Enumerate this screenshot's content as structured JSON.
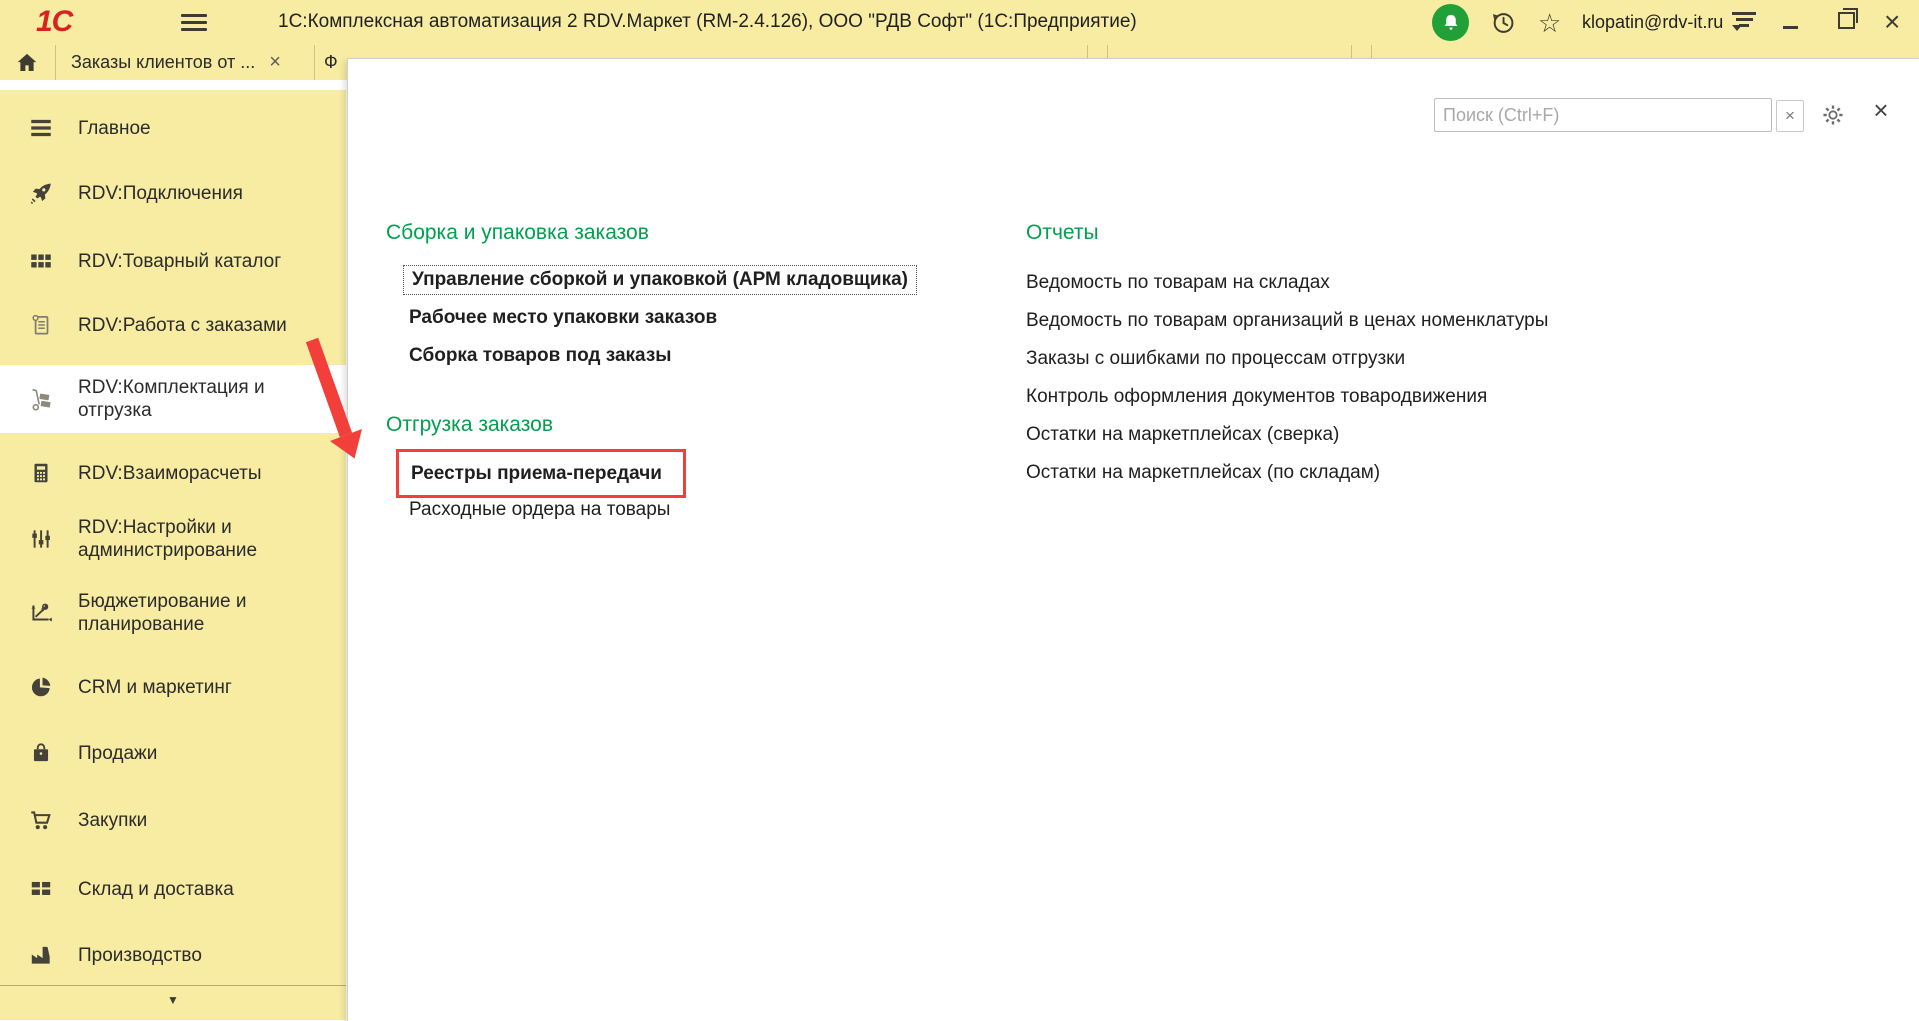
{
  "titlebar": {
    "logo": "1С",
    "app_title": "1С:Комплексная автоматизация 2 RDV.Маркет (RM-2.4.126), ООО \"РДВ Софт\"  (1С:Предприятие)",
    "user_email": "klopatin@rdv-it.ru"
  },
  "tabs": {
    "tab1_label": "Заказы клиентов от ...",
    "tab2_partial": "Ф"
  },
  "sidebar": {
    "items": [
      {
        "label": "Главное"
      },
      {
        "label": "RDV:Подключения"
      },
      {
        "label": "RDV:Товарный каталог"
      },
      {
        "label": "RDV:Работа с заказами"
      },
      {
        "label": "RDV:Комплектация и отгрузка",
        "selected": true
      },
      {
        "label": "RDV:Взаиморасчеты"
      },
      {
        "label": "RDV:Настройки и администрирование"
      },
      {
        "label": "Бюджетирование и планирование"
      },
      {
        "label": "CRM и маркетинг"
      },
      {
        "label": "Продажи"
      },
      {
        "label": "Закупки"
      },
      {
        "label": "Склад и доставка"
      },
      {
        "label": "Производство"
      }
    ]
  },
  "panel": {
    "search_placeholder": "Поиск (Ctrl+F)",
    "sections": [
      {
        "title": "Сборка и упаковка заказов",
        "items": [
          "Управление сборкой и упаковкой (АРМ кладовщика)",
          "Рабочее место упаковки заказов",
          "Сборка товаров под заказы"
        ]
      },
      {
        "title": "Отгрузка заказов",
        "items": [
          "Реестры приема-передачи",
          "Расходные ордера на товары"
        ]
      },
      {
        "title": "Отчеты",
        "items": [
          "Ведомость по товарам на складах",
          "Ведомость по товарам организаций в ценах номенклатуры",
          "Заказы с ошибками по процессам отгрузки",
          "Контроль оформления документов товародвижения",
          "Остатки на маркетплейсах (сверка)",
          "Остатки на маркетплейсах (по складам)"
        ]
      }
    ]
  },
  "icons": {
    "close_x": "×",
    "star": "☆",
    "expand_more": "▼"
  },
  "colors": {
    "accent_yellow": "#f7eca2",
    "brand_green": "#21a038",
    "group_title_green": "#00a04e",
    "highlight_red": "#f23f39"
  }
}
